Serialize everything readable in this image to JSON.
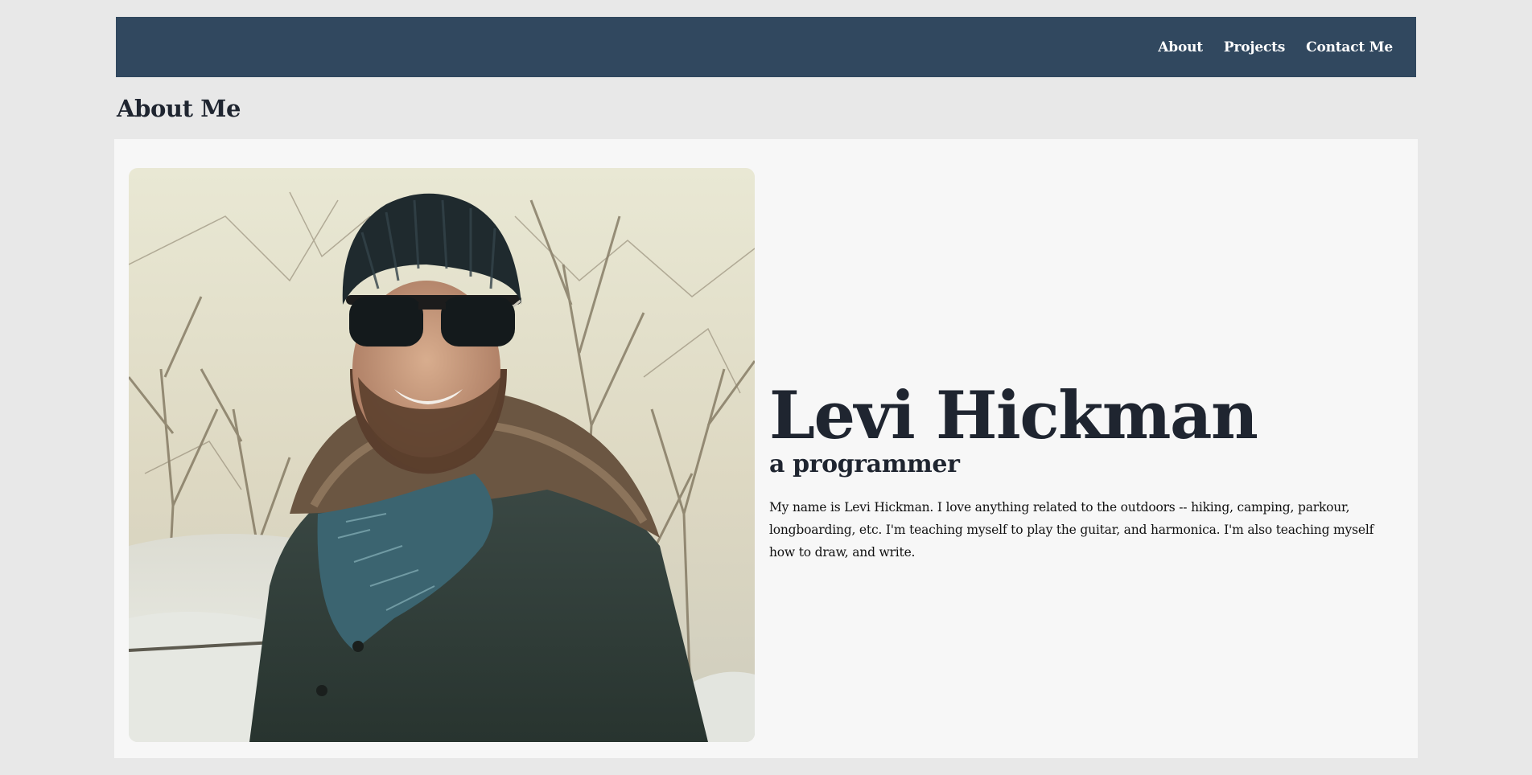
{
  "nav": {
    "links": [
      "About",
      "Projects",
      "Contact Me"
    ]
  },
  "section": {
    "title": "About Me"
  },
  "profile": {
    "name": "Levi Hickman",
    "role": "a programmer",
    "bio": "My name is Levi Hickman. I love anything related to the outdoors -- hiking, camping, parkour, longboarding, etc. I'm teaching myself to play the guitar, and harmonica. I'm also teaching myself how to draw, and write.",
    "photo_icon": "portrait-photo"
  },
  "colors": {
    "navbar": "#31485f",
    "page_background": "#e8e8e8",
    "card_background": "#f7f7f7",
    "heading_text": "#1f2530"
  }
}
